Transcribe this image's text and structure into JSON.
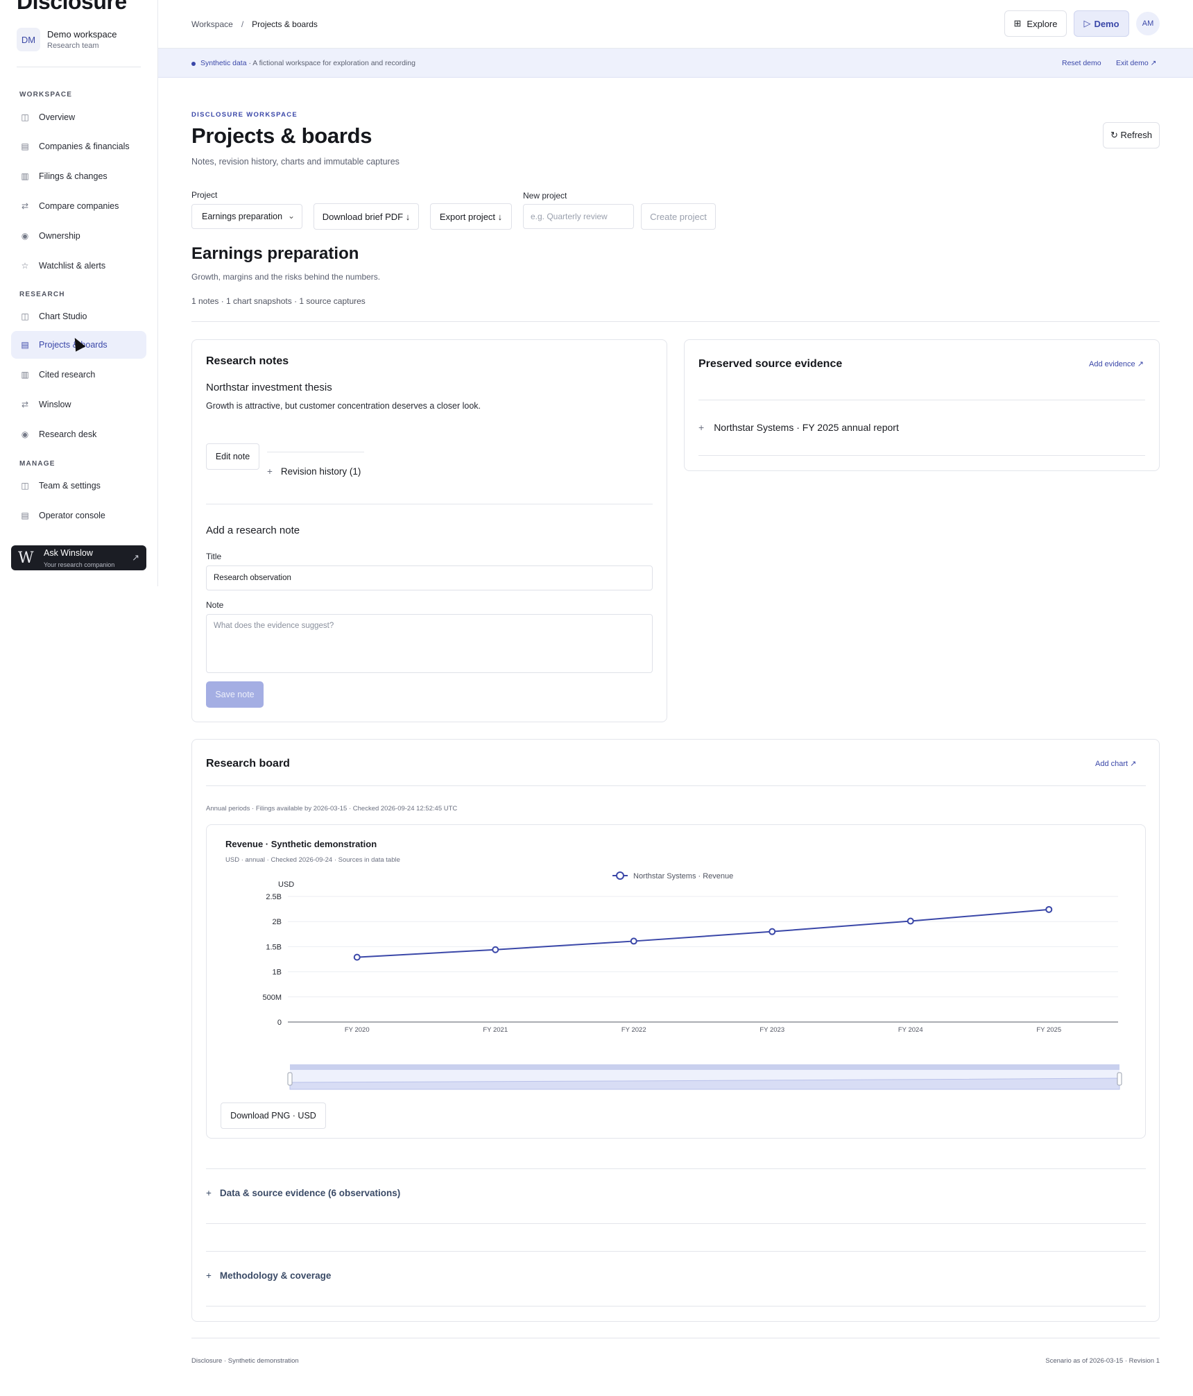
{
  "sidebar": {
    "logo": "Disclosure",
    "workspace": {
      "initials": "DM",
      "name": "Demo workspace",
      "team": "Research team"
    },
    "sections": {
      "workspace": "WORKSPACE",
      "research": "RESEARCH",
      "manage": "MANAGE"
    },
    "items": [
      {
        "label": "Overview",
        "icon": "panel-icon"
      },
      {
        "label": "Companies & financials",
        "icon": "table-icon"
      },
      {
        "label": "Filings & changes",
        "icon": "document-icon"
      },
      {
        "label": "Compare companies",
        "icon": "swap-icon"
      },
      {
        "label": "Ownership",
        "icon": "target-icon"
      },
      {
        "label": "Watchlist & alerts",
        "icon": "star-icon"
      },
      {
        "label": "Chart Studio",
        "icon": "panel-icon"
      },
      {
        "label": "Projects & boards",
        "icon": "table-icon"
      },
      {
        "label": "Cited research",
        "icon": "document-icon"
      },
      {
        "label": "Winslow",
        "icon": "swap-icon"
      },
      {
        "label": "Research desk",
        "icon": "target-icon"
      },
      {
        "label": "Team & settings",
        "icon": "panel-icon"
      },
      {
        "label": "Operator console",
        "icon": "table-icon"
      }
    ],
    "ask": {
      "title": "Ask Winslow",
      "subtitle": "Your research companion"
    }
  },
  "header": {
    "breadcrumb": [
      "Workspace",
      "Projects & boards"
    ],
    "explore_label": "Explore",
    "demo_label": "Demo",
    "user_initials": "AM"
  },
  "banner": {
    "highlight": "Synthetic data",
    "text": " · A fictional workspace for exploration and recording",
    "reset": "Reset demo",
    "exit": "Exit demo ↗"
  },
  "page": {
    "eyebrow": "DISCLOSURE WORKSPACE",
    "title": "Projects & boards",
    "subtitle": "Notes, revision history, charts and immutable captures",
    "refresh_label": "↻ Refresh",
    "project_label": "Project",
    "project_value": "Earnings preparation",
    "download_brief": "Download brief PDF ↓",
    "export_project": "Export project ↓",
    "new_project_label": "New project",
    "new_project_placeholder": "e.g. Quarterly review",
    "create_project": "Create project"
  },
  "project": {
    "title": "Earnings preparation",
    "description": "Growth, margins and the risks behind the numbers.",
    "counts": "1 notes · 1 chart snapshots · 1 source captures"
  },
  "notes": {
    "heading": "Research notes",
    "note_title": "Northstar investment thesis",
    "note_body": "Growth is attractive, but customer concentration deserves a closer look.",
    "edit_label": "Edit note",
    "revision_label": "Revision history (1)",
    "add_heading": "Add a research note",
    "title_label": "Title",
    "title_value": "Research observation",
    "note_label": "Note",
    "note_placeholder": "What does the evidence suggest?",
    "save_label": "Save note"
  },
  "evidence": {
    "heading": "Preserved source evidence",
    "add_label": "Add evidence ↗",
    "item": "Northstar Systems · FY 2025 annual report"
  },
  "board": {
    "heading": "Research board",
    "add_chart": "Add chart ↗",
    "meta": "Annual periods · Filings available by 2026-03-15 · Checked 2026-09-24 12:52:45 UTC",
    "chart_title": "Revenue · Synthetic demonstration",
    "chart_sub": "USD · annual · Checked 2026-09-24 · Sources in data table",
    "download_png": "Download PNG · USD",
    "data_accordion": "Data & source evidence (6 observations)",
    "method_accordion": "Methodology & coverage"
  },
  "footer": {
    "left": "Disclosure · Synthetic demonstration",
    "right": "Scenario as of 2026-03-15 · Revision 1"
  },
  "colors": {
    "accent": "#3a47a8",
    "line": "#3a47a8"
  },
  "chart_data": {
    "type": "line",
    "ylabel": "USD",
    "categories": [
      "FY 2020",
      "FY 2021",
      "FY 2022",
      "FY 2023",
      "FY 2024",
      "FY 2025"
    ],
    "series": [
      {
        "name": "Northstar Systems · Revenue",
        "values": [
          1290000000,
          1440000000,
          1610000000,
          1800000000,
          2010000000,
          2240000000
        ]
      }
    ],
    "yticks": [
      "0",
      "500M",
      "1B",
      "1.5B",
      "2B",
      "2.5B"
    ],
    "ylim": [
      0,
      2500000000
    ],
    "grid": true,
    "legend": "top-center"
  }
}
